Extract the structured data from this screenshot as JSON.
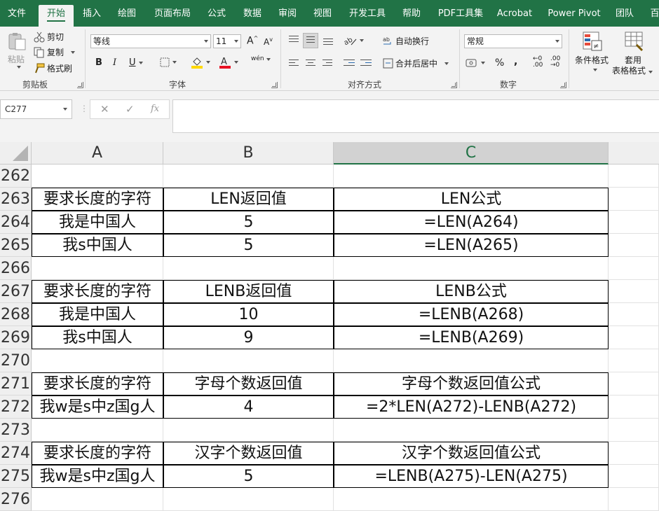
{
  "tabs": [
    "文件",
    "开始",
    "插入",
    "绘图",
    "页面布局",
    "公式",
    "数据",
    "审阅",
    "视图",
    "开发工具",
    "帮助",
    "PDF工具集",
    "Acrobat",
    "Power Pivot",
    "团队",
    "百"
  ],
  "ribbon": {
    "clipboard": {
      "paste": "粘贴",
      "cut": "剪切",
      "copy": "复制",
      "format_painter": "格式刷",
      "label": "剪贴板"
    },
    "font": {
      "font_name": "等线",
      "font_size": "11",
      "bold": "B",
      "italic": "I",
      "underline": "U",
      "increase": "A",
      "decrease": "A",
      "phonetic": "wén",
      "label": "字体",
      "font_color": "#e81123",
      "fill_color": "#ffd800"
    },
    "alignment": {
      "wrap": "自动换行",
      "merge": "合并后居中",
      "label": "对齐方式"
    },
    "number": {
      "format": "常规",
      "percent": "%",
      "comma": ",",
      "inc_decimal": ".00",
      "dec_decimal": ".00",
      "label": "数字"
    },
    "styles": {
      "conditional": "条件格式",
      "table_format_1": "套用",
      "table_format_2": "表格格式"
    }
  },
  "formula_bar": {
    "name_box": "C277",
    "cancel": "✕",
    "enter": "✓",
    "fx": "fx",
    "formula": ""
  },
  "columns": [
    "A",
    "B",
    "C"
  ],
  "selected_column": "C",
  "rows": [
    {
      "num": "262",
      "a": "",
      "b": "",
      "c": ""
    },
    {
      "num": "263",
      "a": "要求长度的字符",
      "b": "LEN返回值",
      "c": "LEN公式"
    },
    {
      "num": "264",
      "a": "我是中国人",
      "b": "5",
      "c": "=LEN(A264)"
    },
    {
      "num": "265",
      "a": "我s中国人",
      "b": "5",
      "c": "=LEN(A265)"
    },
    {
      "num": "266",
      "a": "",
      "b": "",
      "c": ""
    },
    {
      "num": "267",
      "a": "要求长度的字符",
      "b": "LENB返回值",
      "c": "LENB公式"
    },
    {
      "num": "268",
      "a": "我是中国人",
      "b": "10",
      "c": "=LENB(A268)"
    },
    {
      "num": "269",
      "a": "我s中国人",
      "b": "9",
      "c": "=LENB(A269)"
    },
    {
      "num": "270",
      "a": "",
      "b": "",
      "c": ""
    },
    {
      "num": "271",
      "a": "要求长度的字符",
      "b": "字母个数返回值",
      "c": "字母个数返回值公式"
    },
    {
      "num": "272",
      "a": "我w是s中z国g人",
      "b": "4",
      "c": "=2*LEN(A272)-LENB(A272)"
    },
    {
      "num": "273",
      "a": "",
      "b": "",
      "c": ""
    },
    {
      "num": "274",
      "a": "要求长度的字符",
      "b": "汉字个数返回值",
      "c": "汉字个数返回值公式"
    },
    {
      "num": "275",
      "a": "我w是s中z国g人",
      "b": "5",
      "c": "=LENB(A275)-LEN(A275)"
    },
    {
      "num": "276",
      "a": "",
      "b": "",
      "c": ""
    }
  ]
}
